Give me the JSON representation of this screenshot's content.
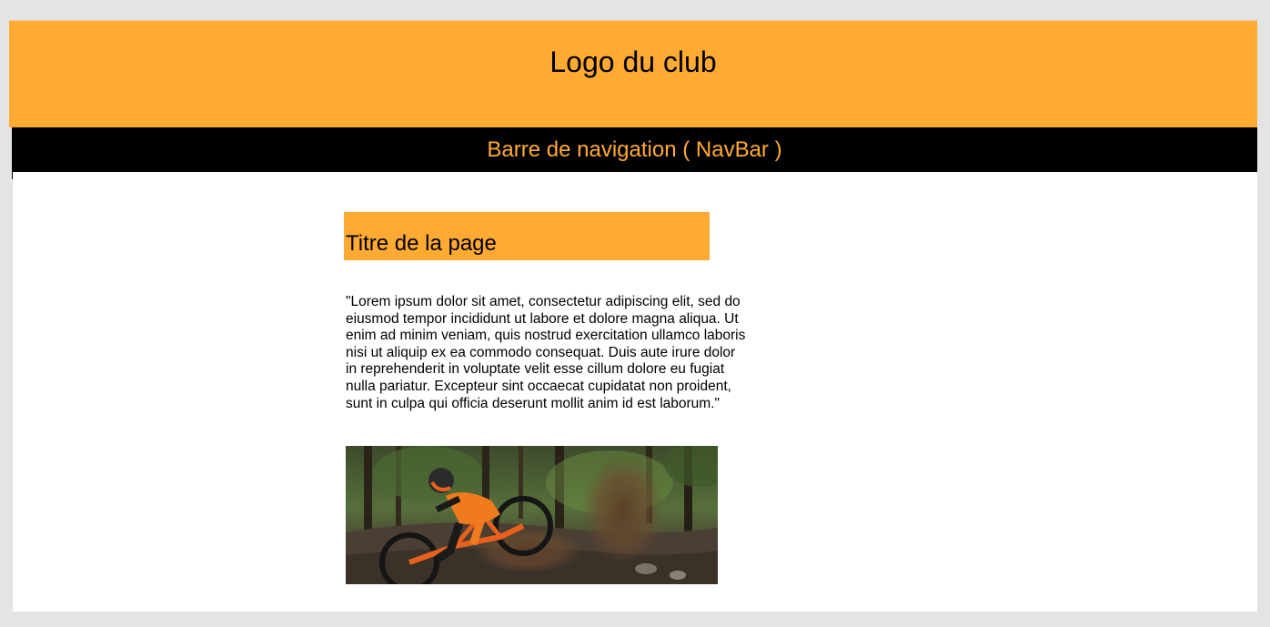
{
  "header": {
    "logo_text": "Logo du club",
    "background_color": "#ffaa33"
  },
  "navbar": {
    "label": "Barre de navigation ( NavBar )",
    "background_color": "#000000",
    "text_color": "#ffaa33"
  },
  "page": {
    "title": "Titre de la page",
    "body": "\"Lorem ipsum dolor sit amet, consectetur adipiscing elit, sed do eiusmod tempor incididunt ut labore et dolore magna aliqua. Ut enim ad minim veniam, quis nostrud exercitation ullamco laboris nisi ut aliquip ex ea commodo consequat. Duis aute irure dolor in reprehenderit in voluptate velit esse cillum dolore eu fugiat nulla pariatur. Excepteur sint occaecat cupidatat non proident, sunt in culpa qui officia deserunt mollit anim id est laborum.\"",
    "image": {
      "subject": "mountain biker in orange riding through forest, kicking up dirt"
    }
  },
  "colors": {
    "accent": "#ffaa33",
    "page_background": "#e4e4e4",
    "content_background": "#ffffff"
  }
}
